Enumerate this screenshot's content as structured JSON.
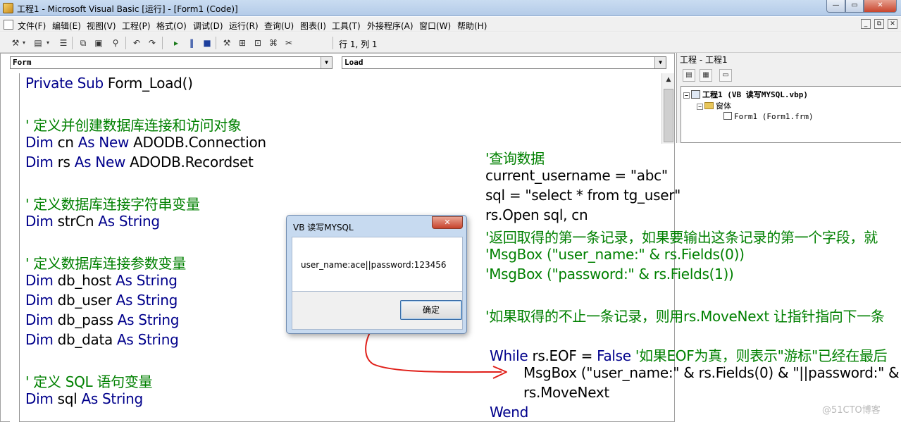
{
  "window": {
    "title": "工程1 - Microsoft Visual Basic [运行] - [Form1 (Code)]",
    "min_glyph": "—",
    "max_glyph": "▭",
    "close_glyph": "✕"
  },
  "menubar": {
    "items": [
      "文件(F)",
      "编辑(E)",
      "视图(V)",
      "工程(P)",
      "格式(O)",
      "调试(D)",
      "运行(R)",
      "查询(U)",
      "图表(I)",
      "工具(T)",
      "外接程序(A)",
      "窗口(W)",
      "帮助(H)"
    ],
    "mdi_min": "_",
    "mdi_restore": "⧉",
    "mdi_close": "✕"
  },
  "toolbar": {
    "cursor_position": "行 1, 列 1"
  },
  "code_window": {
    "object_combo": "Form",
    "procedure_combo": "Load",
    "left_lines": [
      {
        "kw": "Private Sub ",
        "text": "Form_Load()",
        "cm": ""
      },
      {
        "kw": "",
        "text": "",
        "cm": "' 定义并创建数据库连接和访问对象"
      },
      {
        "kw": "Dim ",
        "text": "cn ",
        "kw2": "As New ",
        "text2": "ADODB.Connection"
      },
      {
        "kw": "Dim ",
        "text": "rs ",
        "kw2": "As New ",
        "text2": "ADODB.Recordset"
      },
      {
        "kw": "",
        "text": "",
        "cm": "' 定义数据库连接字符串变量"
      },
      {
        "kw": "Dim ",
        "text": "strCn ",
        "kw2": "As String",
        "text2": ""
      },
      {
        "kw": "",
        "text": "",
        "cm": "' 定义数据库连接参数变量"
      },
      {
        "kw": "Dim ",
        "text": "db_host ",
        "kw2": "As String",
        "text2": ""
      },
      {
        "kw": "Dim ",
        "text": "db_user ",
        "kw2": "As String",
        "text2": ""
      },
      {
        "kw": "Dim ",
        "text": "db_pass ",
        "kw2": "As String",
        "text2": ""
      },
      {
        "kw": "Dim ",
        "text": "db_data ",
        "kw2": "As String",
        "text2": ""
      },
      {
        "kw": "",
        "text": "",
        "cm": "' 定义 SQL 语句变量"
      },
      {
        "kw": "Dim ",
        "text": "sql ",
        "kw2": "As String",
        "text2": ""
      }
    ],
    "right_lines": {
      "c1": "'查询数据",
      "l2": "current_username = \"abc\"",
      "l3": "sql = \"select * from tg_user\"",
      "l4": "rs.Open sql, cn",
      "c5": "'返回取得的第一条记录，如果要输出这条记录的第一个字段，就",
      "c6": "'MsgBox (\"user_name:\" & rs.Fields(0))",
      "c7": "'MsgBox (\"password:\" & rs.Fields(1))",
      "c8a": "'如果取得的不止一条记录，则用",
      "c8b": "rs.MoveNext",
      "c8c": " 让指针指向下一条",
      "w_kw": "While ",
      "w_text": "rs.EOF = ",
      "w_kw2": "False ",
      "w_cm": "'如果EOF为真，则表示\"游标\"已经在最后",
      "mb": "MsgBox (\"user_name:\" & rs.Fields(0) & \"||password:\" &",
      "mn": "rs.MoveNext",
      "wend": "Wend"
    }
  },
  "project_explorer": {
    "title": "工程 - 工程1",
    "project_node": "工程1 (VB 读写MYSQL.vbp)",
    "folder_node": "窗体",
    "form_node": "Form1 (Form1.frm)",
    "expand_glyph": "−"
  },
  "msgbox": {
    "title": "VB 读写MYSQL",
    "message": "user_name:ace||password:123456",
    "ok_label": "确定",
    "close_glyph": "✕"
  },
  "watermark": "@51CTO博客",
  "colors": {
    "keyword": "#00008b",
    "comment": "#008000",
    "annotation": "#e0201a"
  }
}
